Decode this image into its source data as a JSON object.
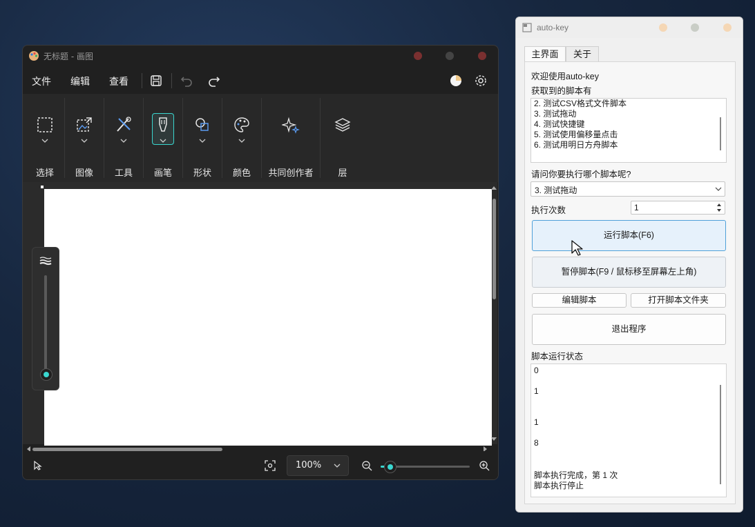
{
  "paint": {
    "title": "无标题 - 画图",
    "menu": {
      "file": "文件",
      "edit": "编辑",
      "view": "查看"
    },
    "ribbon": [
      {
        "label": "选择",
        "icon": "selection-icon"
      },
      {
        "label": "图像",
        "icon": "image-icon"
      },
      {
        "label": "工具",
        "icon": "tools-icon"
      },
      {
        "label": "画笔",
        "icon": "brush-icon"
      },
      {
        "label": "形状",
        "icon": "shapes-icon"
      },
      {
        "label": "颜色",
        "icon": "palette-icon"
      },
      {
        "label": "共同创作者",
        "icon": "sparkle-icon"
      },
      {
        "label": "层",
        "icon": "layers-icon"
      }
    ],
    "status": {
      "zoom": "100%",
      "zoom_level": 0.1
    },
    "brush_size_level": 0.05,
    "colors": {
      "accent": "#3ad7d0",
      "window_btn": "#7a3030"
    }
  },
  "autokey": {
    "title": "auto-key",
    "tabs": {
      "main": "主界面",
      "about": "关于"
    },
    "welcome": "欢迎使用auto-key",
    "scripts_label": "获取到的脚本有",
    "scripts": [
      "2. 测试CSV格式文件脚本",
      "3. 测试拖动",
      "4. 测试快捷键",
      "5. 测试使用偏移量点击",
      "6. 测试用明日方舟脚本"
    ],
    "question": "请问你要执行哪个脚本呢?",
    "selected_script": "3. 测试拖动",
    "run_count_label": "执行次数",
    "run_count_value": "1",
    "run_button": "运行脚本(F6)",
    "pause_button": "暂停脚本(F9 / 鼠标移至屏幕左上角)",
    "edit_button": "编辑脚本",
    "open_folder_button": "打开脚本文件夹",
    "exit_button": "退出程序",
    "status_label": "脚本运行状态",
    "log": [
      "0",
      "1",
      "1",
      "8",
      "脚本执行完成，第 1 次",
      "脚本执行停止"
    ],
    "colors": {
      "dot": "#f5d7b5",
      "dot_mid": "#c9cdc6",
      "primary_border": "#4ea0d9"
    }
  }
}
